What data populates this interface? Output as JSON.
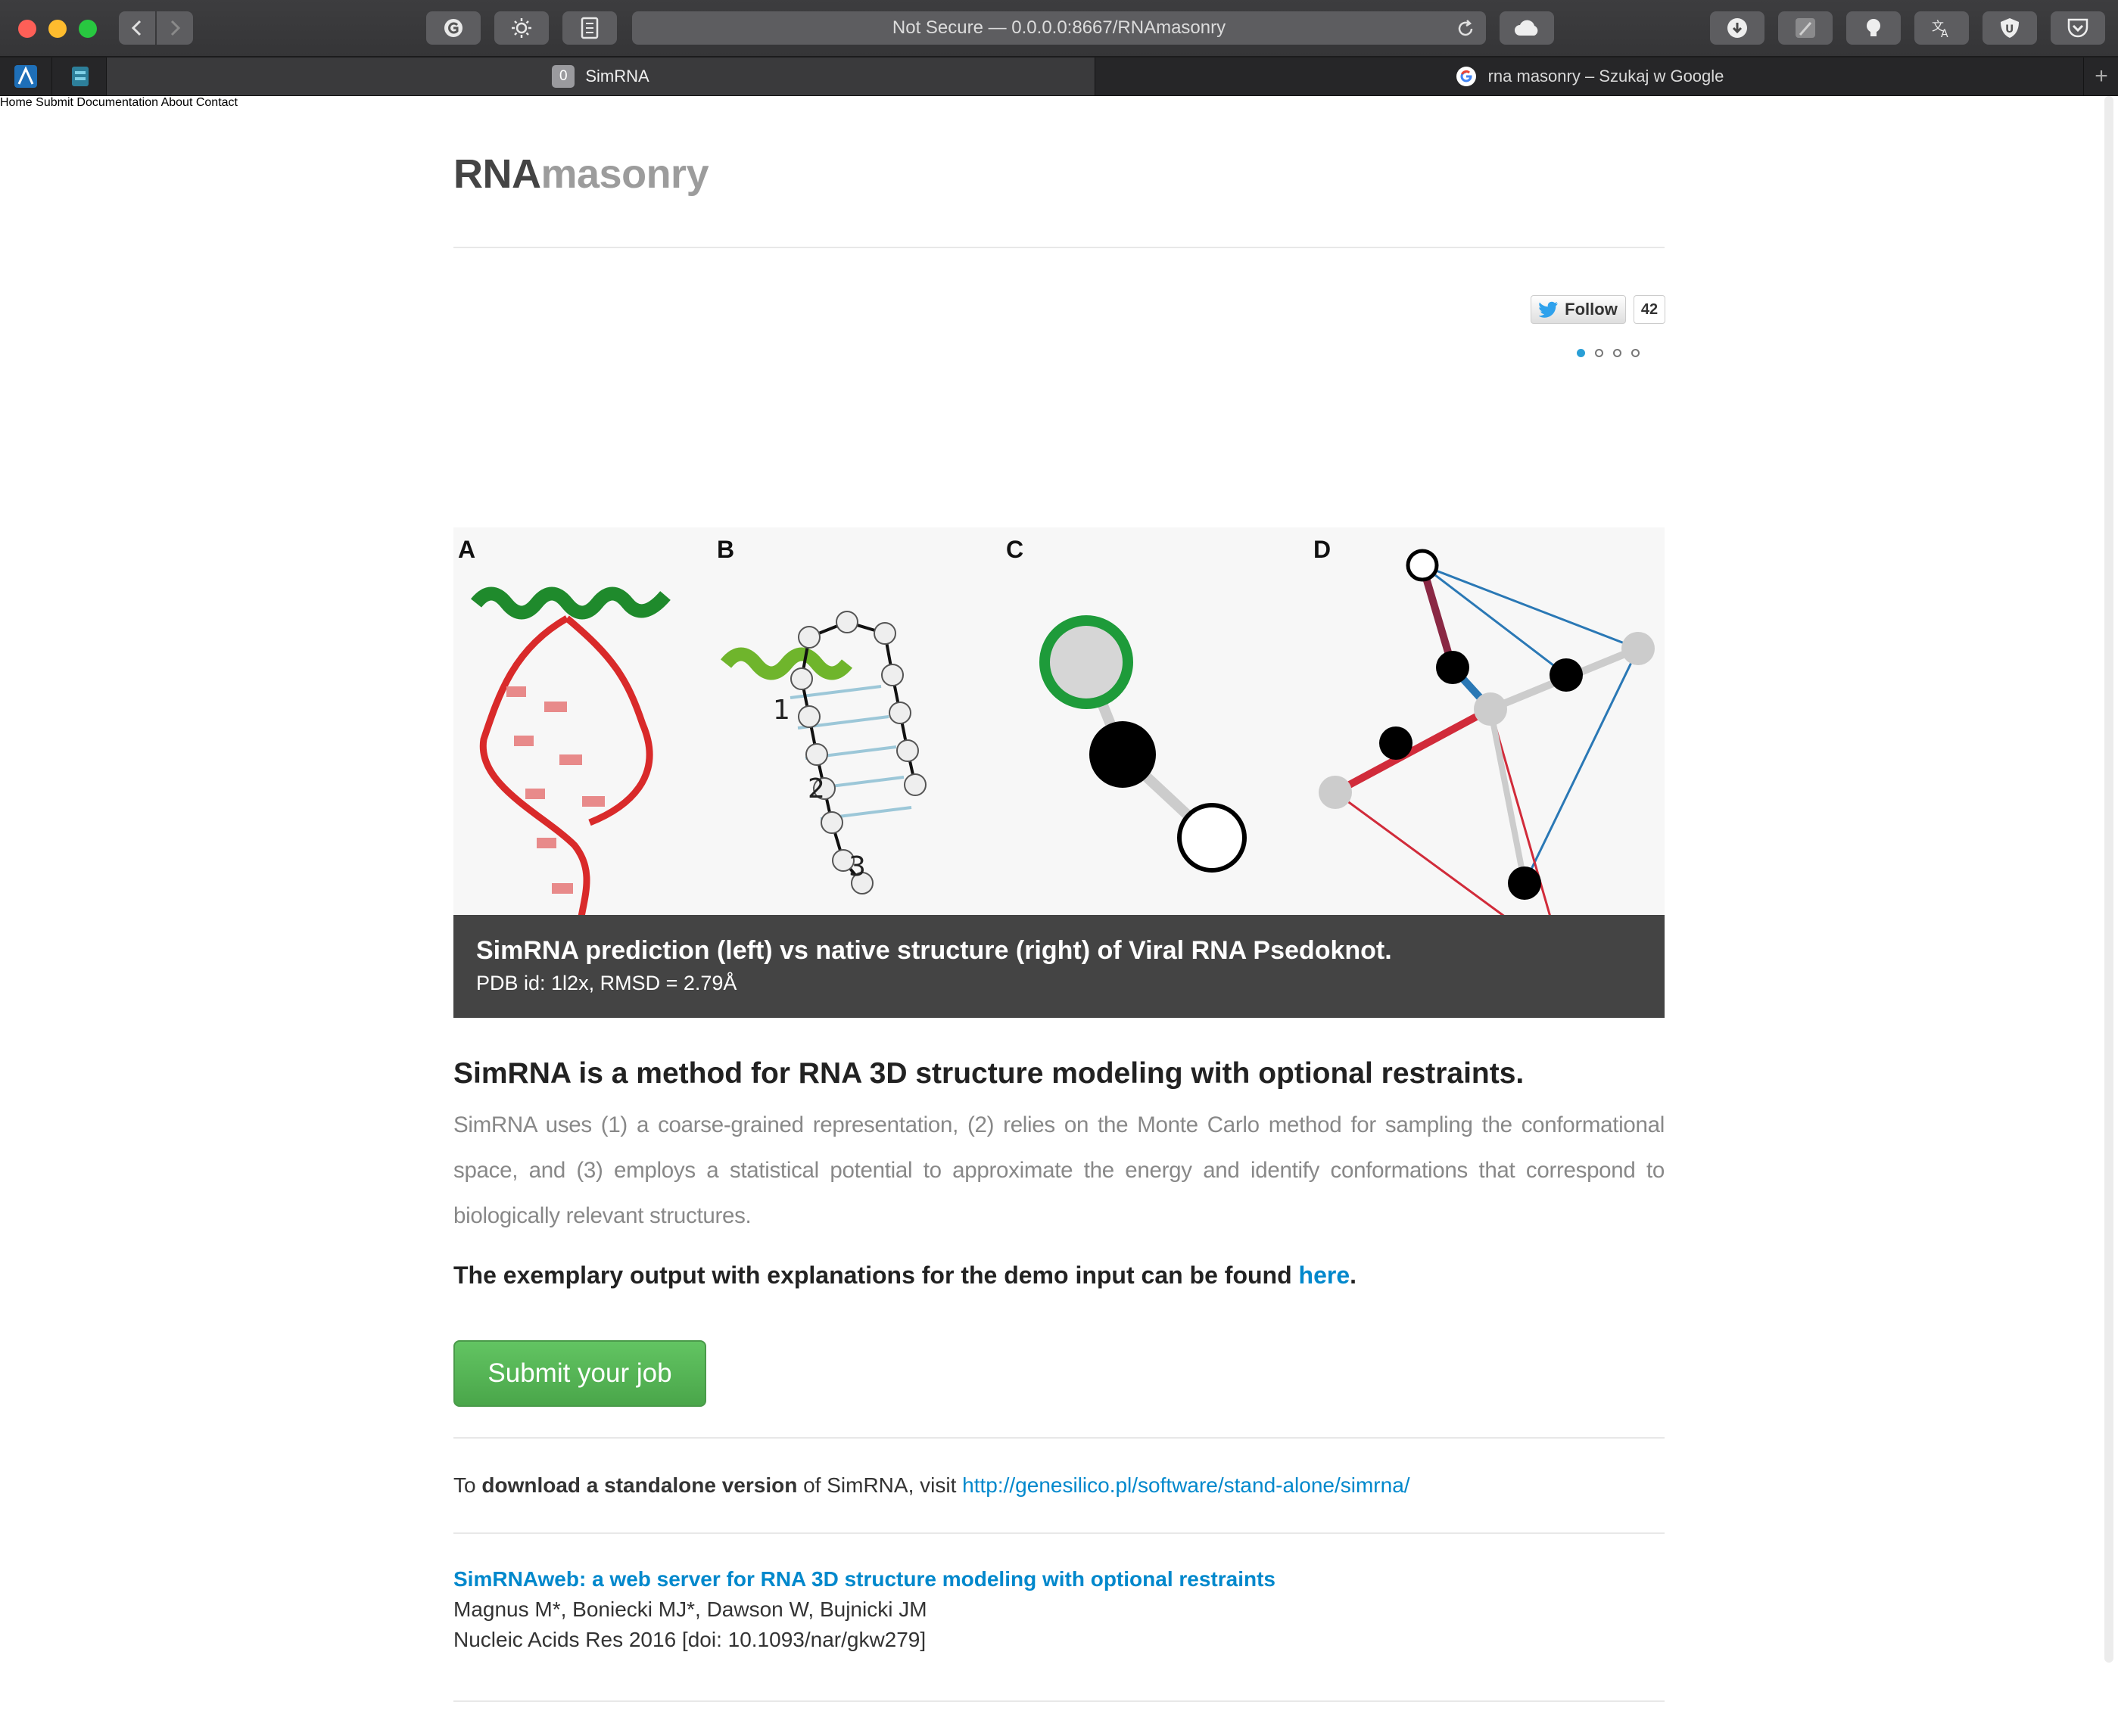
{
  "browser": {
    "url_text": "Not Secure — 0.0.0.0:8667/RNAmasonry",
    "tabs": [
      {
        "badge": "0",
        "label": "SimRNA",
        "active": true
      },
      {
        "label": "rna masonry – Szukaj w Google",
        "active": false
      }
    ],
    "new_tab": "+"
  },
  "site": {
    "brand_dark": "RNA",
    "brand_light": "masonry",
    "nav": [
      "Home",
      "Submit",
      "Documentation",
      "About",
      "Contact"
    ]
  },
  "twitter": {
    "follow_label": "Follow",
    "count": "42"
  },
  "carousel": {
    "slides": 4,
    "active_index": 0
  },
  "figure": {
    "panels": [
      "A",
      "B",
      "C",
      "D"
    ],
    "numbers": [
      "1",
      "2",
      "3"
    ]
  },
  "caption": {
    "title": "SimRNA prediction (left) vs native structure (right) of Viral RNA Psedoknot.",
    "subtitle": "PDB id: 1l2x, RMSD = 2.79Å"
  },
  "intro": {
    "lead": "SimRNA is a method for RNA 3D structure modeling with optional restraints.",
    "body": "SimRNA uses (1) a coarse-grained representation, (2) relies on the Monte Carlo method for sampling the conformational space, and (3) employs a statistical potential to approximate the energy and identify conformations that correspond to biologically relevant structures."
  },
  "exemplary": {
    "text": "The exemplary output with explanations for the demo input can be found ",
    "link": "here",
    "end": "."
  },
  "submit_label": "Submit your job",
  "download": {
    "pre": "To ",
    "bold": "download a standalone version",
    "mid": " of SimRNA, visit ",
    "url": "http://genesilico.pl/software/stand-alone/simrna/"
  },
  "paper": {
    "title": "SimRNAweb: a web server for RNA 3D structure modeling with optional restraints",
    "authors": "Magnus M*, Boniecki MJ*, Dawson W, Bujnicki JM",
    "journal": "Nucleic Acids Res 2016 [doi: 10.1093/nar/gkw279]"
  },
  "colors": {
    "link": "#0088cc",
    "caption_bg": "#444444",
    "button": "#5cb85c"
  }
}
